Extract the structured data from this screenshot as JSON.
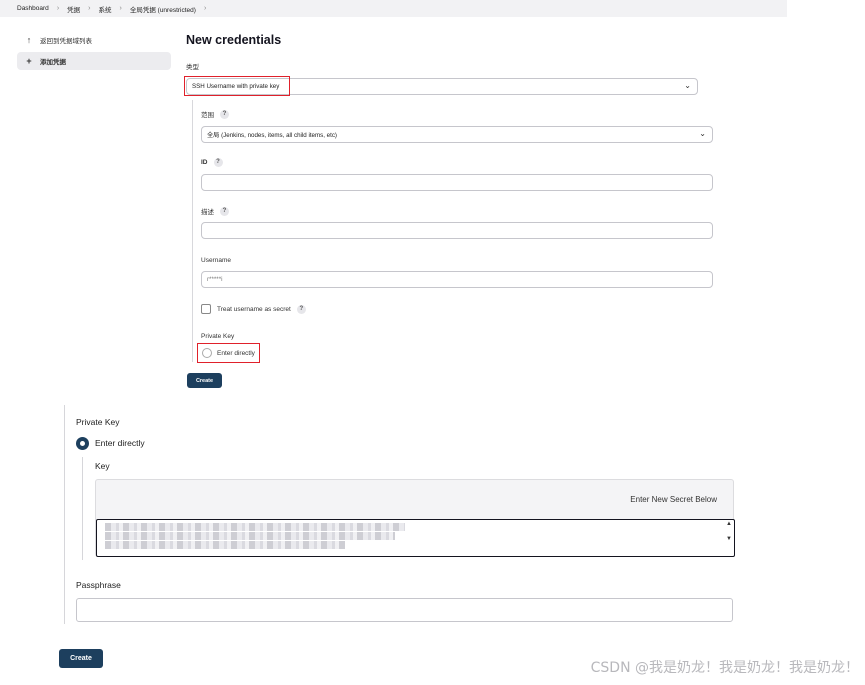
{
  "breadcrumb": [
    "Dashboard",
    "凭据",
    "系统",
    "全局凭据 (unrestricted)"
  ],
  "sidebar": {
    "items": [
      {
        "icon": "arrow-up-icon",
        "label": "返回到凭据域列表"
      },
      {
        "icon": "plus-icon",
        "label": "添加凭据"
      }
    ]
  },
  "page": {
    "title": "New credentials",
    "kind_label": "类型",
    "kind_value": "SSH Username with private key",
    "scope_label": "范围",
    "scope_value": "全局 (Jenkins, nodes, items, all child items, etc)",
    "id_label": "ID",
    "id_value": "",
    "description_label": "描述",
    "description_value": "",
    "username_label": "Username",
    "username_value": "r*****i",
    "treat_secret_label": "Treat username as secret",
    "private_key_label": "Private Key",
    "enter_directly_label": "Enter directly",
    "create_label": "Create",
    "help_glyph": "?"
  },
  "expanded": {
    "private_key_label": "Private Key",
    "enter_directly_label": "Enter directly",
    "key_label": "Key",
    "key_hint": "Enter New Secret Below",
    "passphrase_label": "Passphrase",
    "passphrase_value": "",
    "create_label": "Create"
  },
  "watermark": "CSDN @我是奶龙！我是奶龙！我是奶龙！",
  "colors": {
    "primary": "#1d3f5e",
    "highlight_red": "#e0212b",
    "breadcrumb_bg": "#f2f2f4"
  }
}
